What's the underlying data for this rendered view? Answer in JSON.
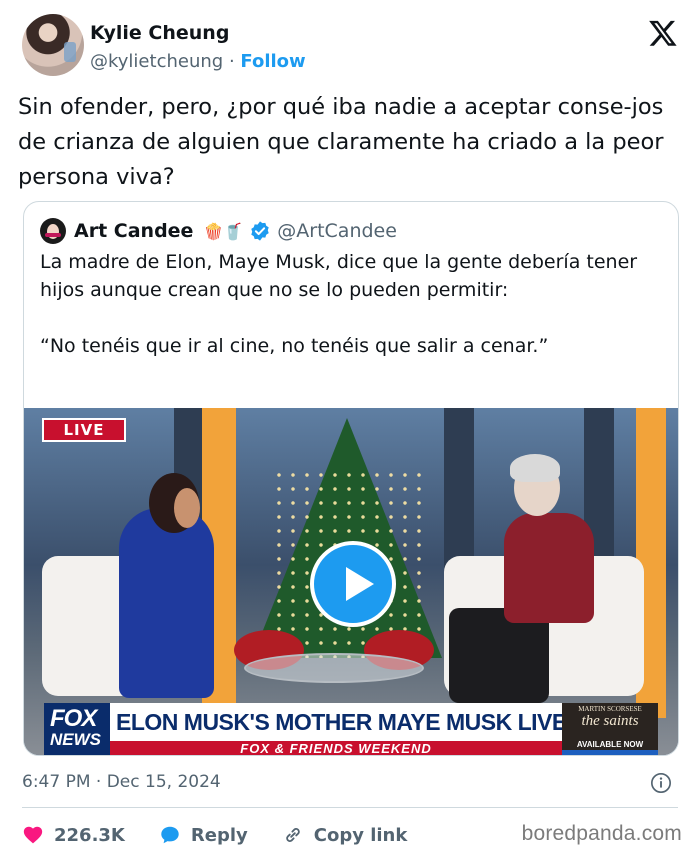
{
  "tweet": {
    "author_name": "Kylie Cheung",
    "author_handle": "@kylietcheung",
    "separator": "·",
    "follow_label": "Follow",
    "text": "Sin ofender, pero, ¿por qué iba nadie a aceptar conse-jos de crianza de alguien que claramente ha criado a la peor persona viva?",
    "timestamp": "6:47 PM · Dec 15, 2024"
  },
  "quote": {
    "author_name": "Art Candee",
    "emojis": "🍿🥤",
    "author_handle": "@ArtCandee",
    "paragraph_1": "La madre de Elon, Maye Musk, dice que la gente debería tener hijos aunque crean que no se lo pueden permitir:",
    "paragraph_2": "“No tenéis que ir al cine, no tenéis que salir a cenar.”"
  },
  "video": {
    "live_label": "LIVE",
    "network_logo_top": "FOX",
    "network_logo_bottom": "NEWS",
    "headline": "ELON MUSK'S MOTHER MAYE MUSK LIVE ON F&F",
    "subline": "FOX & FRIENDS WEEKEND",
    "promo_line1": "MARTIN SCORSESE",
    "promo_title": "the saints",
    "promo_cta": "AVAILABLE NOW"
  },
  "actions": {
    "likes": "226.3K",
    "reply_label": "Reply",
    "copy_link_label": "Copy link"
  },
  "watermark": "boredpanda.com",
  "colors": {
    "accent": "#1d9bf0",
    "like": "#f91880",
    "text": "#0f1419",
    "muted": "#536471"
  },
  "icons": [
    "x-logo-icon",
    "verified-badge-icon",
    "play-icon",
    "info-icon",
    "heart-icon",
    "reply-icon",
    "link-icon"
  ]
}
